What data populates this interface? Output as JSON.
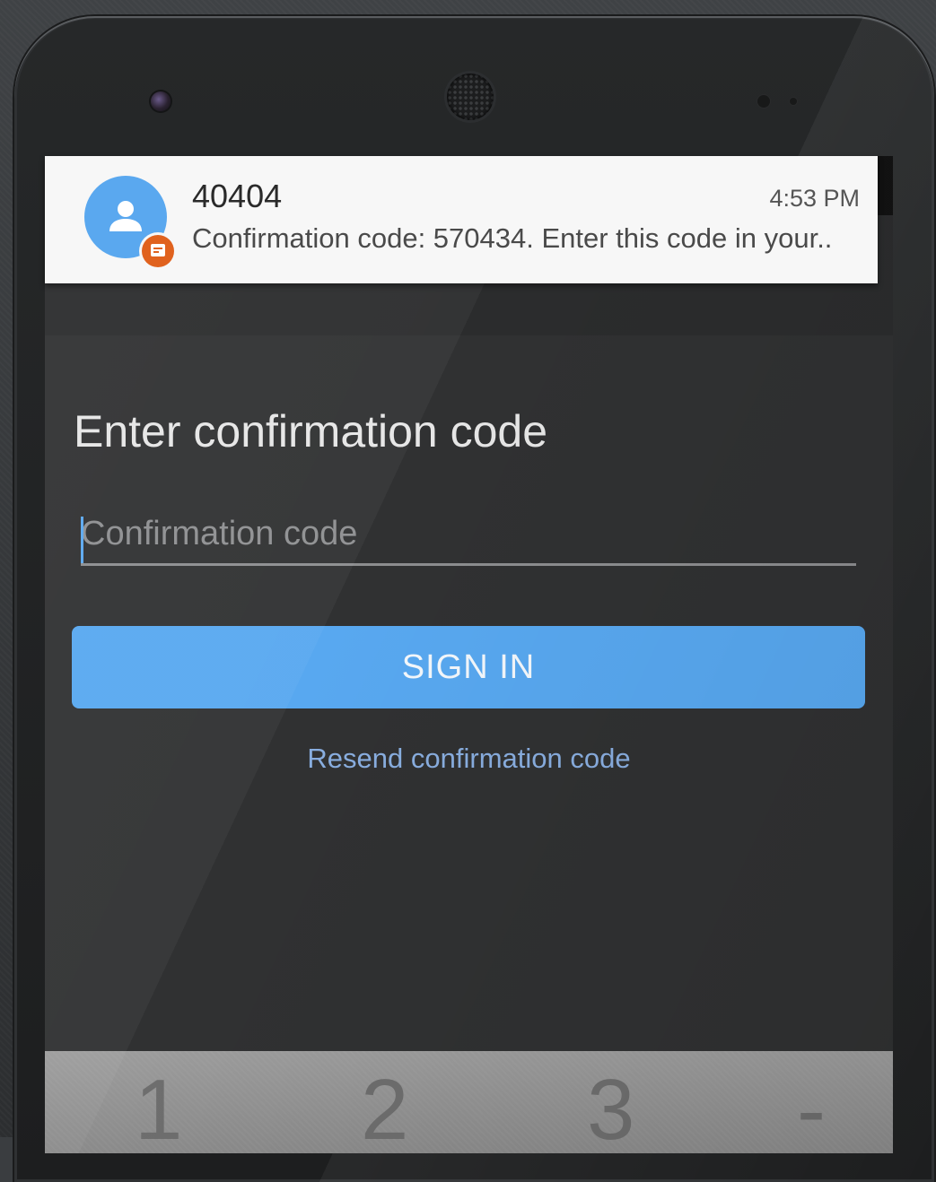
{
  "notification": {
    "sender": "40404",
    "time": "4:53 PM",
    "body": "Confirmation code: 570434. Enter this code in your..",
    "avatar_icon": "person-icon",
    "app_badge_icon": "message-app-icon",
    "avatar_color": "#5aa8ef",
    "badge_color": "#e0621e"
  },
  "screen": {
    "heading": "Enter confirmation code",
    "code_input": {
      "placeholder": "Confirmation code",
      "value": ""
    },
    "sign_in_label": "SIGN IN",
    "resend_label": "Resend confirmation code",
    "accent_color": "#58a8f0"
  },
  "keyboard": {
    "keys": [
      "1",
      "2",
      "3",
      "-"
    ]
  }
}
